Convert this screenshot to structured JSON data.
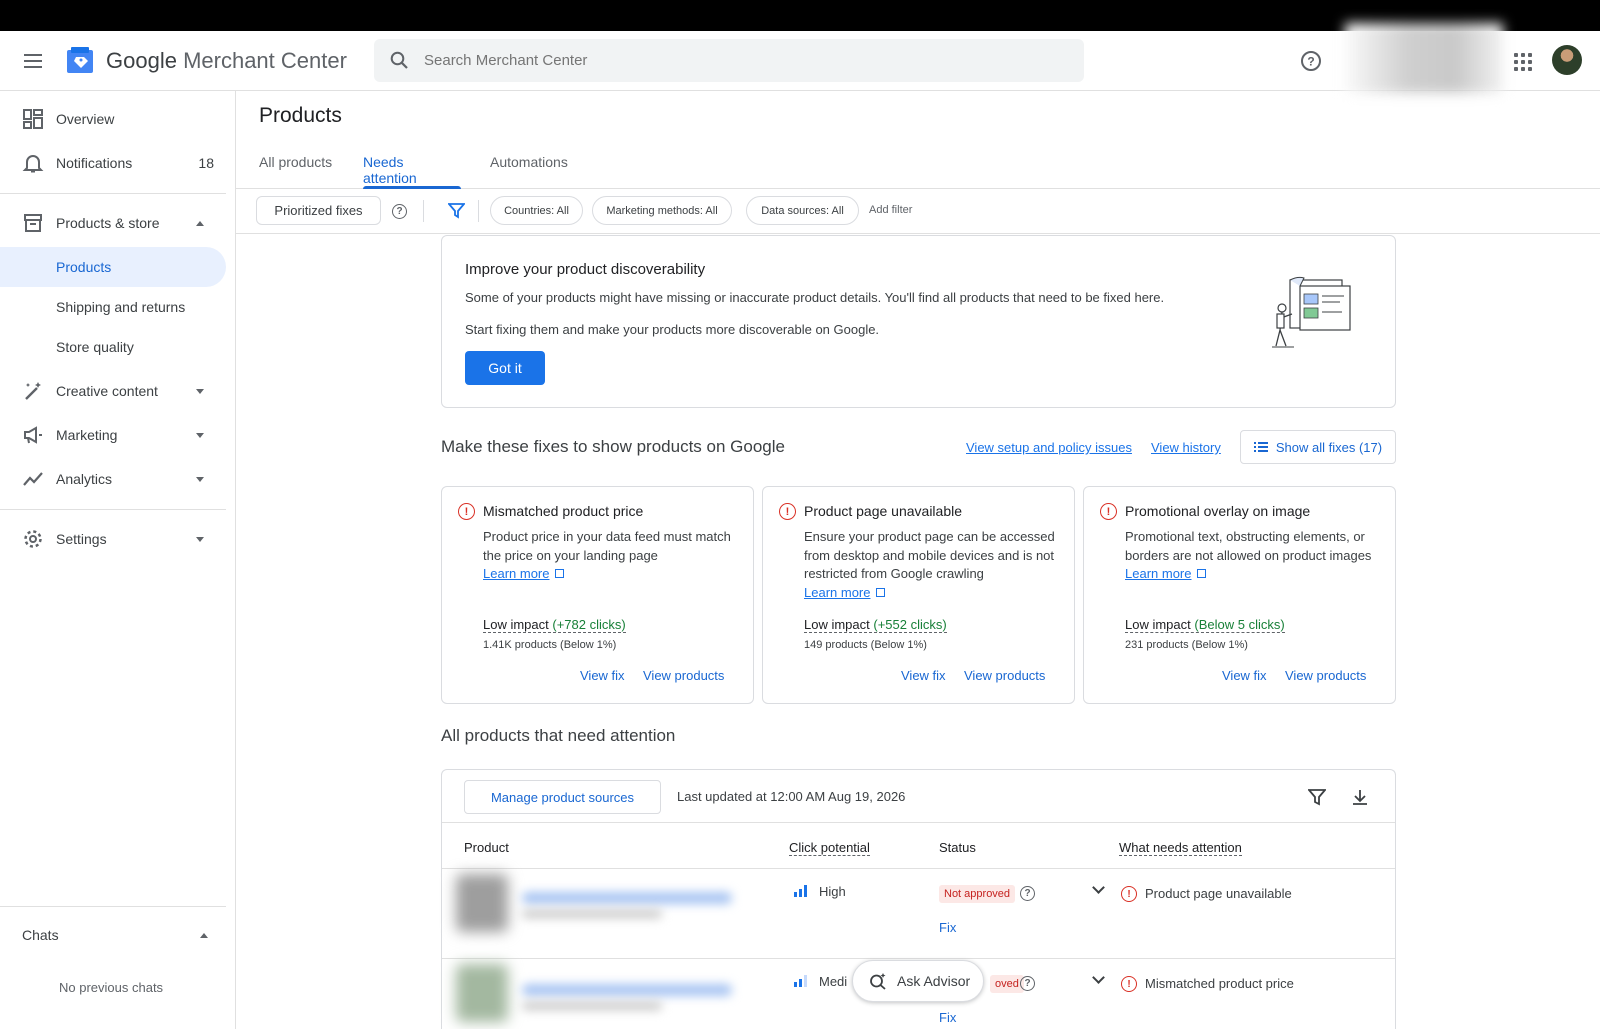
{
  "app": {
    "title_part1": "Google",
    "title_part2": "Merchant Center"
  },
  "search": {
    "placeholder": "Search Merchant Center"
  },
  "sidebar": {
    "overview": "Overview",
    "notifications": "Notifications",
    "notifications_count": "18",
    "products_store": "Products & store",
    "products": "Products",
    "shipping": "Shipping and returns",
    "store_quality": "Store quality",
    "creative": "Creative content",
    "marketing": "Marketing",
    "analytics": "Analytics",
    "settings": "Settings",
    "chats": "Chats",
    "no_chats": "No previous chats"
  },
  "page": {
    "title": "Products",
    "tabs": [
      "All products",
      "Needs attention",
      "Automations"
    ]
  },
  "filters": {
    "prioritized": "Prioritized fixes",
    "countries": "Countries: All",
    "marketing": "Marketing methods: All",
    "sources": "Data sources: All",
    "add": "Add filter"
  },
  "discover": {
    "title": "Improve your product discoverability",
    "line1": "Some of your products might have missing or inaccurate product details. You'll find all products that need to be fixed here.",
    "line2": "Start fixing them and make your products more discoverable on Google.",
    "button": "Got it"
  },
  "fixes": {
    "title": "Make these fixes to show products on Google",
    "setup_link": "View setup and policy issues",
    "history_link": "View history",
    "show_all": "Show all fixes (17)",
    "cards": [
      {
        "title": "Mismatched product price",
        "desc": "Product price in your data feed must match the price on your landing page",
        "learn": "Learn more",
        "impact": "Low impact",
        "impact_detail": "(+782 clicks)",
        "products": "1.41K products (Below 1%)",
        "view_fix": "View fix",
        "view_products": "View products"
      },
      {
        "title": "Product page unavailable",
        "desc": "Ensure your product page can be accessed from desktop and mobile devices and is not restricted from Google crawling",
        "learn": "Learn more",
        "impact": "Low impact",
        "impact_detail": "(+552 clicks)",
        "products": "149 products (Below 1%)",
        "view_fix": "View fix",
        "view_products": "View products"
      },
      {
        "title": "Promotional overlay on image",
        "desc": "Promotional text, obstructing elements, or borders are not allowed on product images",
        "learn": "Learn more",
        "impact": "Low impact",
        "impact_detail": "(Below 5 clicks)",
        "products": "231 products (Below 1%)",
        "view_fix": "View fix",
        "view_products": "View products"
      }
    ]
  },
  "attention": {
    "title": "All products that need attention",
    "manage": "Manage product sources",
    "updated": "Last updated at 12:00 AM Aug 19, 2026",
    "columns": [
      "Product",
      "Click potential",
      "Status",
      "What needs attention"
    ],
    "rows": [
      {
        "potential": "High",
        "status": "Not approved",
        "fix": "Fix",
        "issue": "Product page unavailable"
      },
      {
        "potential": "Medi",
        "status": "oved",
        "fix": "Fix",
        "issue": "Mismatched product price"
      }
    ]
  },
  "advisor": {
    "label": "Ask Advisor"
  },
  "colors": {
    "accent": "#1a73e8",
    "error": "#d93025",
    "positive": "#188038"
  }
}
